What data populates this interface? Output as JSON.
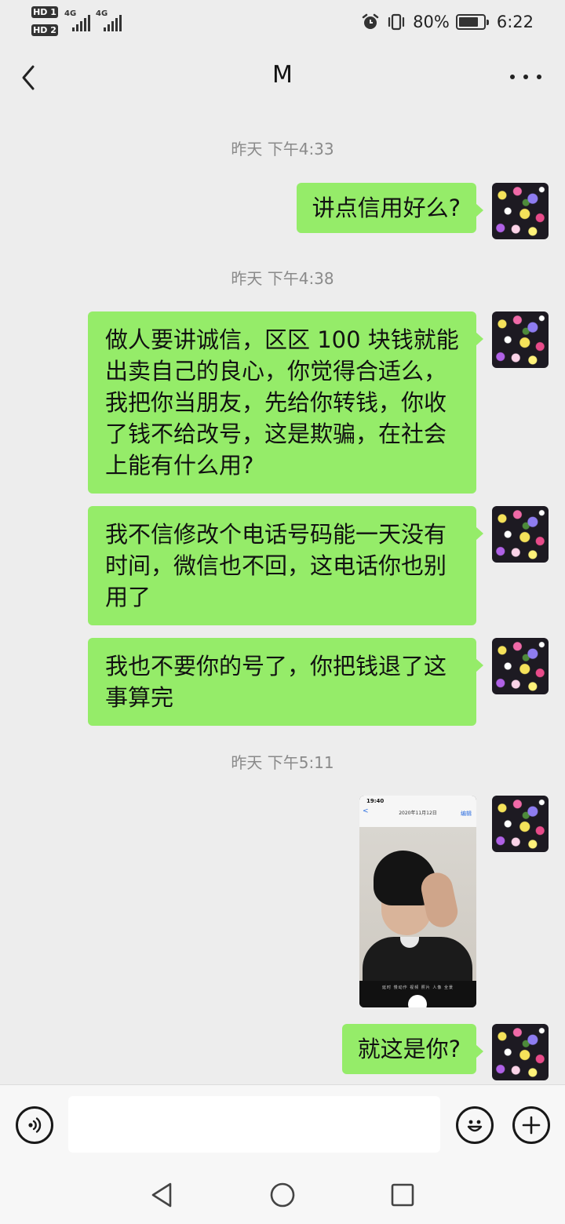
{
  "status_bar": {
    "hd1": "HD 1",
    "hd2": "HD 2",
    "net1": "4G",
    "net2": "4G",
    "battery_percent": "80%",
    "battery_level": 0.8,
    "time": "6:22"
  },
  "header": {
    "title": "M"
  },
  "messages": [
    {
      "type": "timestamp",
      "text": "昨天 下午4:33"
    },
    {
      "type": "text",
      "sender": "self",
      "text": "讲点信用好么?"
    },
    {
      "type": "timestamp",
      "text": "昨天 下午4:38"
    },
    {
      "type": "text",
      "sender": "self",
      "text": "做人要讲诚信，区区 100 块钱就能\n出卖自己的良心，你觉得合适么，\n我把你当朋友，先给你转钱，你收\n了钱不给改号，这是欺骗，在社会\n上能有什么用?"
    },
    {
      "type": "text",
      "sender": "self",
      "text": "我不信修改个电话号码能一天没有\n时间，微信也不回，这电话你也别\n用了"
    },
    {
      "type": "text",
      "sender": "self",
      "text": "我也不要你的号了，你把钱退了这\n事算完"
    },
    {
      "type": "timestamp",
      "text": "昨天 下午5:11"
    },
    {
      "type": "image",
      "sender": "self",
      "screenshot_time": "19:40",
      "screenshot_date": "2020年11月12日",
      "screenshot_edit": "编辑",
      "camera_modes": "延时  慢动作  视频  照片  人像  全景"
    },
    {
      "type": "text",
      "sender": "self",
      "text": "就这是你?"
    }
  ],
  "input_bar": {
    "voice_icon": "voice-icon",
    "emoji_icon": "emoji-icon",
    "plus_icon": "plus-icon",
    "input_value": ""
  },
  "nav_bar": {
    "back_icon": "triangle-back-icon",
    "home_icon": "circle-home-icon",
    "recent_icon": "square-recent-icon"
  },
  "colors": {
    "background": "#ededed",
    "bubble_self": "#95ec69",
    "timestamp_text": "#8a8a8a"
  }
}
